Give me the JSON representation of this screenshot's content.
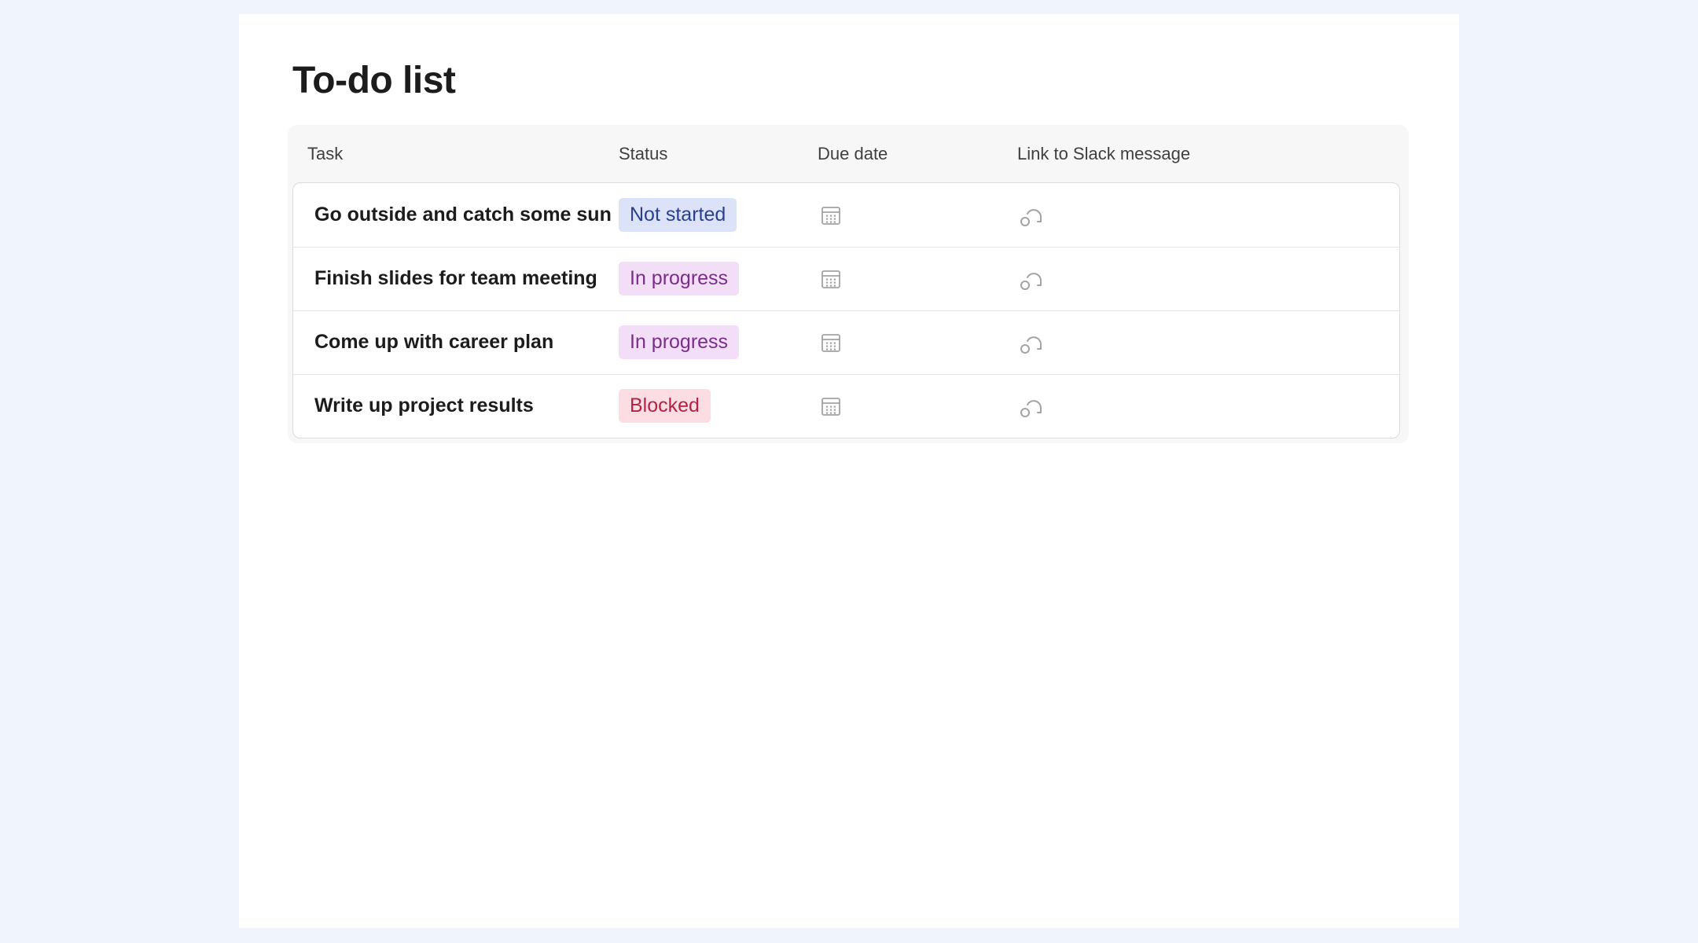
{
  "page": {
    "title": "To-do list"
  },
  "table": {
    "columns": [
      "Task",
      "Status",
      "Due date",
      "Link to Slack message"
    ],
    "rows": [
      {
        "task": "Go outside and catch some sun",
        "status": "Not started",
        "status_bg": "#dce3f8",
        "status_fg": "#2a3f8f",
        "due_icon": "calendar-icon",
        "link_icon": "slack-message-link-icon"
      },
      {
        "task": "Finish slides for team meeting",
        "status": "In progress",
        "status_bg": "#f2def6",
        "status_fg": "#7a2d8a",
        "due_icon": "calendar-icon",
        "link_icon": "slack-message-link-icon"
      },
      {
        "task": "Come up with career plan",
        "status": "In progress",
        "status_bg": "#f2def6",
        "status_fg": "#7a2d8a",
        "due_icon": "calendar-icon",
        "link_icon": "slack-message-link-icon"
      },
      {
        "task": "Write up project results",
        "status": "Blocked",
        "status_bg": "#fbdde3",
        "status_fg": "#b32244",
        "due_icon": "calendar-icon",
        "link_icon": "slack-message-link-icon"
      }
    ]
  },
  "colors": {
    "page_background": "#eff4fd",
    "canvas_background": "#ffffff",
    "icon_gray": "#a3a3a3"
  }
}
